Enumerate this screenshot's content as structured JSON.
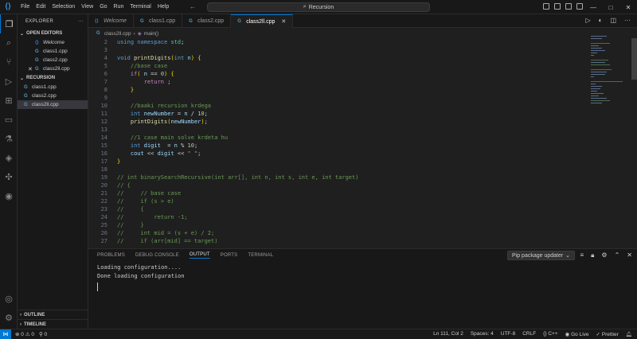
{
  "menu": [
    "File",
    "Edit",
    "Selection",
    "View",
    "Go",
    "Run",
    "Terminal",
    "Help"
  ],
  "search": {
    "label": "Recursion"
  },
  "sidebar": {
    "title": "EXPLORER",
    "open_editors_label": "OPEN EDITORS",
    "open_editors": [
      {
        "label": "Welcome",
        "icon": "vscode-icon"
      },
      {
        "label": "class1.cpp",
        "icon": "cpp-icon"
      },
      {
        "label": "class2.cpp",
        "icon": "cpp-icon"
      },
      {
        "label": "class2ll.cpp",
        "icon": "cpp-icon"
      }
    ],
    "folder_label": "RECURSION",
    "files": [
      "class1.cpp",
      "class2.cpp",
      "class2ll.cpp"
    ],
    "outline_label": "OUTLINE",
    "timeline_label": "TIMELINE"
  },
  "tabs": [
    {
      "label": "Welcome",
      "icon": "vscode-icon"
    },
    {
      "label": "class1.cpp",
      "icon": "cpp-icon"
    },
    {
      "label": "class2.cpp",
      "icon": "cpp-icon"
    },
    {
      "label": "class2ll.cpp",
      "icon": "cpp-icon"
    }
  ],
  "breadcrumb": {
    "file": "class2ll.cpp",
    "symbol": "main()"
  },
  "editor": {
    "lines": [
      {
        "n": "2",
        "text": "using namespace std;"
      },
      {
        "n": "3",
        "text": ""
      },
      {
        "n": "4",
        "text": "void printDigits(int n) {"
      },
      {
        "n": "5",
        "text": "    //base case"
      },
      {
        "n": "6",
        "text": "    if( n == 0) {"
      },
      {
        "n": "7",
        "text": "        return ;"
      },
      {
        "n": "8",
        "text": "    }"
      },
      {
        "n": "9",
        "text": ""
      },
      {
        "n": "10",
        "text": "    //baaki recursion krdega"
      },
      {
        "n": "11",
        "text": "    int newNumber = n / 10;"
      },
      {
        "n": "12",
        "text": "    printDigits(newNumber);"
      },
      {
        "n": "13",
        "text": ""
      },
      {
        "n": "14",
        "text": "    //1 case main solve krdeta hu"
      },
      {
        "n": "15",
        "text": "    int digit  = n % 10;"
      },
      {
        "n": "16",
        "text": "    cout << digit << \" \";"
      },
      {
        "n": "17",
        "text": "}"
      },
      {
        "n": "18",
        "text": ""
      },
      {
        "n": "19",
        "text": "// int binarySearchRecursive(int arr[], int n, int s, int e, int target)"
      },
      {
        "n": "20",
        "text": "// {"
      },
      {
        "n": "21",
        "text": "//     // base case"
      },
      {
        "n": "22",
        "text": "//     if (s > e)"
      },
      {
        "n": "23",
        "text": "//     {"
      },
      {
        "n": "24",
        "text": "//         return -1;"
      },
      {
        "n": "25",
        "text": "//     }"
      },
      {
        "n": "26",
        "text": "//     int mid = (s + e) / 2;"
      },
      {
        "n": "27",
        "text": "//     if (arr[mid] == target)"
      }
    ]
  },
  "panel": {
    "tabs": [
      "PROBLEMS",
      "DEBUG CONSOLE",
      "OUTPUT",
      "PORTS",
      "TERMINAL"
    ],
    "active_tab": "OUTPUT",
    "dropdown": "Pip package updater",
    "output": [
      "Loading configuration....",
      "Done loading configuration"
    ]
  },
  "status": {
    "errors": "0",
    "warnings": "0",
    "ports": "0",
    "position": "Ln 111, Col 2",
    "spaces": "Spaces: 4",
    "encoding": "UTF-8",
    "eol": "CRLF",
    "language": "C++",
    "golive": "Go Live",
    "prettier": "Prettier"
  },
  "colors": {
    "accent": "#0078d4",
    "bg": "#1f1f1f",
    "sidebar_bg": "#181818"
  }
}
